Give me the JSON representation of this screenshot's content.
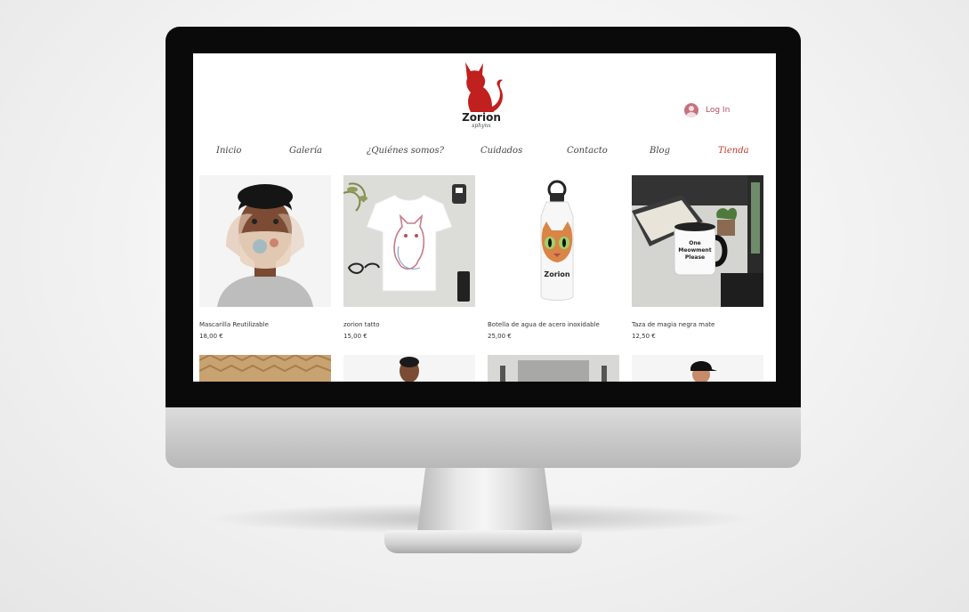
{
  "site": {
    "logo_title": "Zorion",
    "logo_sub": "sphynx",
    "login_label": "Log In"
  },
  "nav": {
    "items": [
      {
        "label": "Inicio",
        "active": false
      },
      {
        "label": "Galería",
        "active": false
      },
      {
        "label": "¿Quiénes somos?",
        "active": false
      },
      {
        "label": "Cuidados",
        "active": false
      },
      {
        "label": "Contacto",
        "active": false
      },
      {
        "label": "Blog",
        "active": false
      },
      {
        "label": "Tienda",
        "active": true
      }
    ]
  },
  "products": [
    {
      "name": "Mascarilla Reutilizable",
      "price": "18,00 €",
      "image": "face-mask-model"
    },
    {
      "name": "zorion tatto",
      "price": "15,00 €",
      "image": "white-tshirt-sphynx"
    },
    {
      "name": "Botella de agua de acero inoxidable",
      "price": "25,00 €",
      "image": "water-bottle"
    },
    {
      "name": "Taza de magia negra mate",
      "price": "12,50 €",
      "image": "black-mug"
    }
  ],
  "colors": {
    "accent": "#c0392b",
    "login": "#b44a5e",
    "logo_cat": "#c0201e"
  }
}
